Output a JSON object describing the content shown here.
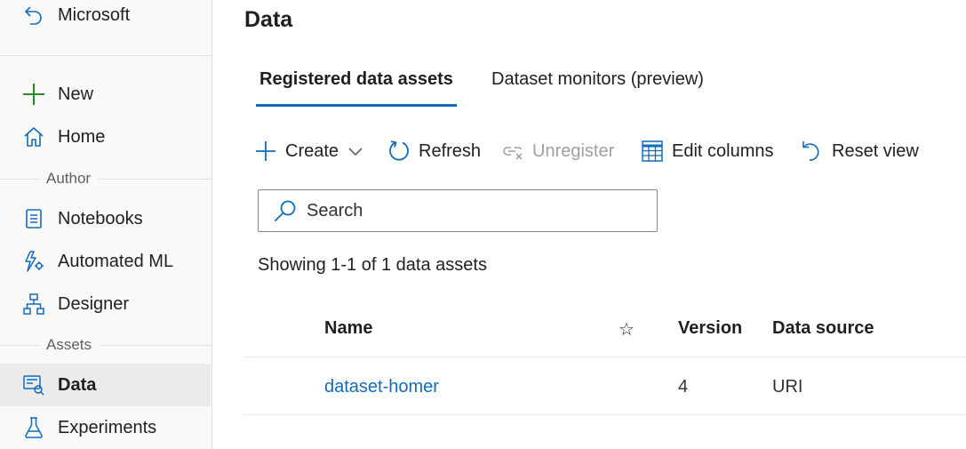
{
  "sidebar": {
    "workspace": "Microsoft",
    "items": [
      {
        "label": "New"
      },
      {
        "label": "Home"
      },
      {
        "label": "Notebooks"
      },
      {
        "label": "Automated ML"
      },
      {
        "label": "Designer"
      },
      {
        "label": "Data"
      },
      {
        "label": "Experiments"
      }
    ],
    "sections": {
      "author": "Author",
      "assets": "Assets"
    },
    "selected": "Data"
  },
  "main": {
    "title": "Data",
    "tabs": [
      {
        "label": "Registered data assets",
        "active": true
      },
      {
        "label": "Dataset monitors (preview)",
        "active": false
      }
    ],
    "toolbar": {
      "create": "Create",
      "refresh": "Refresh",
      "unregister": "Unregister",
      "edit_columns": "Edit columns",
      "reset_view": "Reset view"
    },
    "search": {
      "placeholder": "Search",
      "value": ""
    },
    "showing": "Showing 1-1 of 1 data assets",
    "table": {
      "columns": [
        "Name",
        "☆",
        "Version",
        "Data source"
      ],
      "rows": [
        {
          "name": "dataset-homer",
          "version": "4",
          "data_source": "URI"
        }
      ]
    }
  },
  "colors": {
    "accent": "#0f6cbd",
    "new_icon": "#107c10",
    "text": "#201f1e",
    "disabled": "#a19f9d"
  }
}
